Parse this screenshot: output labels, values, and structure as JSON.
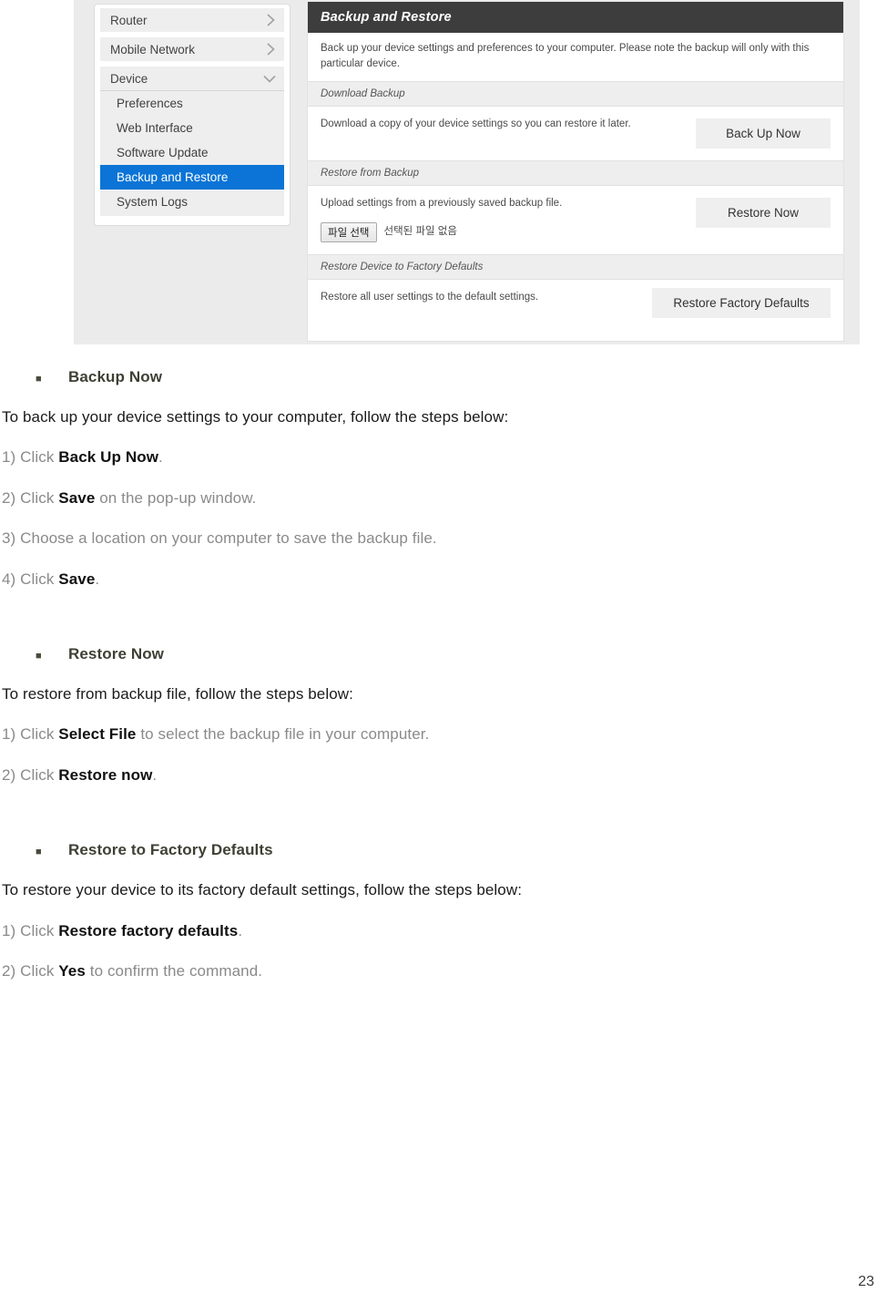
{
  "screenshot": {
    "sidebar": {
      "top_items": [
        {
          "label": "Router",
          "icon": "chevron-right-icon",
          "expanded": false
        },
        {
          "label": "Mobile Network",
          "icon": "chevron-right-icon",
          "expanded": false
        },
        {
          "label": "Device",
          "icon": "chevron-down-icon",
          "expanded": true
        }
      ],
      "sub_items": [
        {
          "label": "Preferences",
          "active": false
        },
        {
          "label": "Web Interface",
          "active": false
        },
        {
          "label": "Software Update",
          "active": false
        },
        {
          "label": "Backup and Restore",
          "active": true
        },
        {
          "label": "System Logs",
          "active": false
        }
      ],
      "active_color": "#0b74d6"
    },
    "panel": {
      "header_title": "Backup and Restore",
      "header_color": "#3d3d3d",
      "intro": "Back up your device settings and preferences to your computer. Please note the backup will only with this particular device.",
      "sections": [
        {
          "heading": "Download Backup",
          "description": "Download a copy of your device settings so you can restore it later.",
          "button": "Back Up Now"
        },
        {
          "heading": "Restore from Backup",
          "description": "Upload settings from a previously saved backup file.",
          "button": "Restore Now",
          "file_button": "파일 선택",
          "file_status": "선택된 파일 없음"
        },
        {
          "heading": "Restore Device to Factory Defaults",
          "description": "Restore all user settings to the default settings.",
          "button": "Restore Factory Defaults"
        }
      ]
    }
  },
  "document": {
    "sections": [
      {
        "bullet": "■",
        "heading": "Backup Now",
        "intro": "To back up your device settings to your computer, follow the steps below:",
        "steps": [
          {
            "num": "1) Click ",
            "bold": "Back Up Now",
            "tail": "."
          },
          {
            "num": "2) Click ",
            "bold": "Save",
            "tail": " on the pop-up window."
          },
          {
            "num": "3) Choose a location on your computer to save the backup file.",
            "bold": "",
            "tail": ""
          },
          {
            "num": "4) Click ",
            "bold": "Save",
            "tail": "."
          }
        ]
      },
      {
        "bullet": "■",
        "heading": "Restore Now",
        "intro": "To restore from backup file, follow the steps below:",
        "steps": [
          {
            "num": "1) Click ",
            "bold": "Select File",
            "tail": " to select the backup file in your computer."
          },
          {
            "num": "2) Click ",
            "bold": "Restore now",
            "tail": "."
          }
        ]
      },
      {
        "bullet": "■",
        "heading": "Restore to Factory Defaults",
        "intro": "To restore your device to its factory default settings, follow the steps below:",
        "steps": [
          {
            "num": "1) Click ",
            "bold": "Restore factory defaults",
            "tail": "."
          },
          {
            "num": "2) Click ",
            "bold": "Yes",
            "tail": " to confirm the command."
          }
        ]
      }
    ],
    "page_number": "23"
  }
}
